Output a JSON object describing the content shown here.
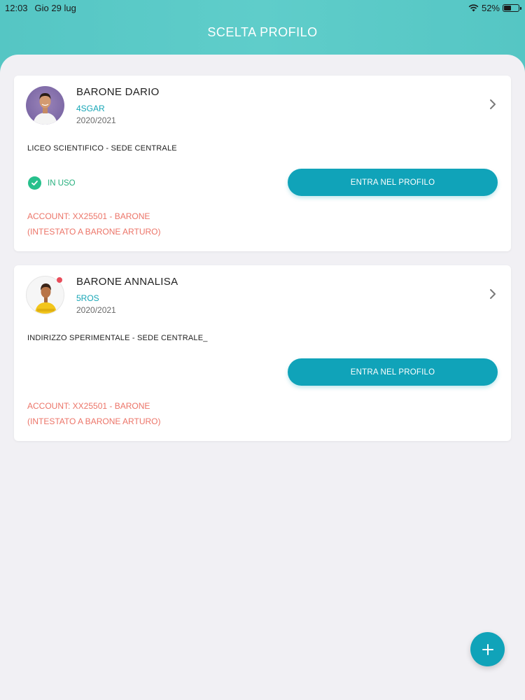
{
  "status_bar": {
    "time": "12:03",
    "date": "Gio 29 lug",
    "battery": "52%",
    "battery_level": 0.52,
    "wifi_icon": "wifi-icon"
  },
  "header": {
    "title": "SCELTA PROFILO"
  },
  "colors": {
    "accent": "#10a3b9",
    "header": "#5fcdca",
    "account_text": "#ec7468",
    "in_use": "#27c08c",
    "badge_red": "#e94d5b"
  },
  "profiles": [
    {
      "name": "BARONE DARIO",
      "class": "4SGAR",
      "year": "2020/2021",
      "school": "LICEO SCIENTIFICO - SEDE CENTRALE",
      "status": "IN USO",
      "button": "ENTRA NEL PROFILO",
      "account": "ACCOUNT: XX25501 - BARONE",
      "owner": "(INTESTATO A BARONE ARTURO)"
    },
    {
      "name": "BARONE ANNALISA",
      "class": "5ROS",
      "year": "2020/2021",
      "school": "INDIRIZZO SPERIMENTALE - SEDE CENTRALE_",
      "button": "ENTRA NEL PROFILO",
      "account": "ACCOUNT: XX25501 - BARONE",
      "owner": "(INTESTATO A BARONE ARTURO)"
    }
  ],
  "fab": {
    "icon": "plus-icon"
  }
}
